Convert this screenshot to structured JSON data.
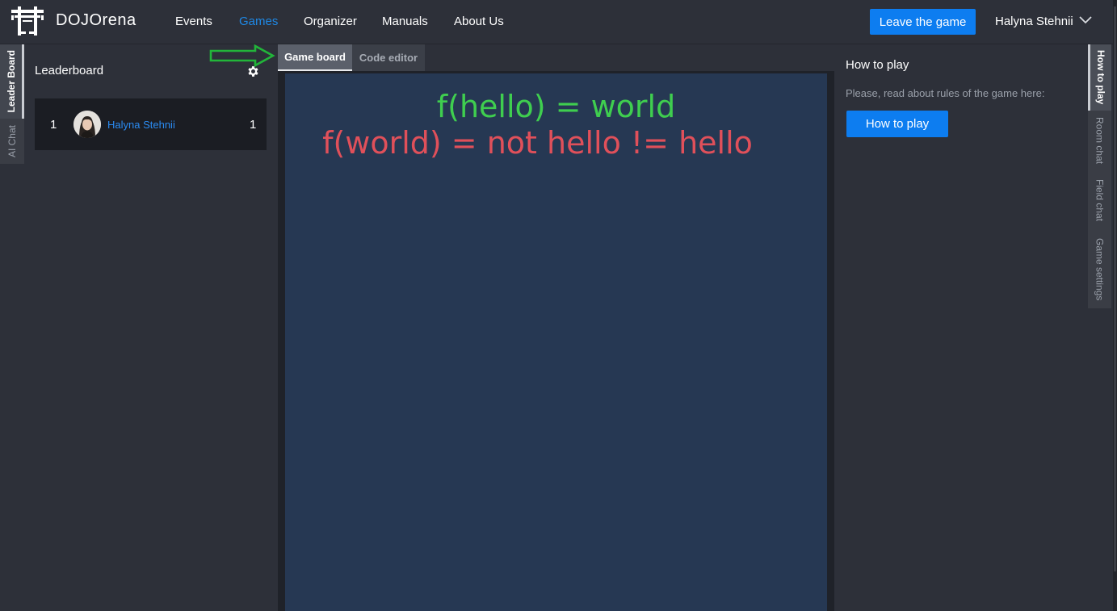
{
  "header": {
    "brand": "DOJOrena",
    "nav": [
      "Events",
      "Games",
      "Organizer",
      "Manuals",
      "About Us"
    ],
    "active_nav": "Games",
    "leave_button": "Leave the game",
    "user_name": "Halyna Stehnii"
  },
  "left_tabs": [
    "Leader Board",
    "AI Chat"
  ],
  "leaderboard": {
    "title": "Leaderboard",
    "rows": [
      {
        "rank": "1",
        "name": "Halyna Stehnii",
        "score": "1"
      }
    ]
  },
  "center_tabs": [
    "Game board",
    "Code editor"
  ],
  "board": {
    "line1": "f(hello) = world",
    "line2": "f(world) = not hello != hello",
    "line1_color": "#3fce4f",
    "line2_color": "#e0505a"
  },
  "right_panel": {
    "title": "How to play",
    "text": "Please, read about rules of the game here:",
    "button": "How to play"
  },
  "right_tabs": [
    "How to play",
    "Room chat",
    "Field chat",
    "Game settings"
  ],
  "colors": {
    "accent": "#0d7df0",
    "link": "#2a8bf2",
    "background": "#2d3039",
    "board": "#263853"
  }
}
